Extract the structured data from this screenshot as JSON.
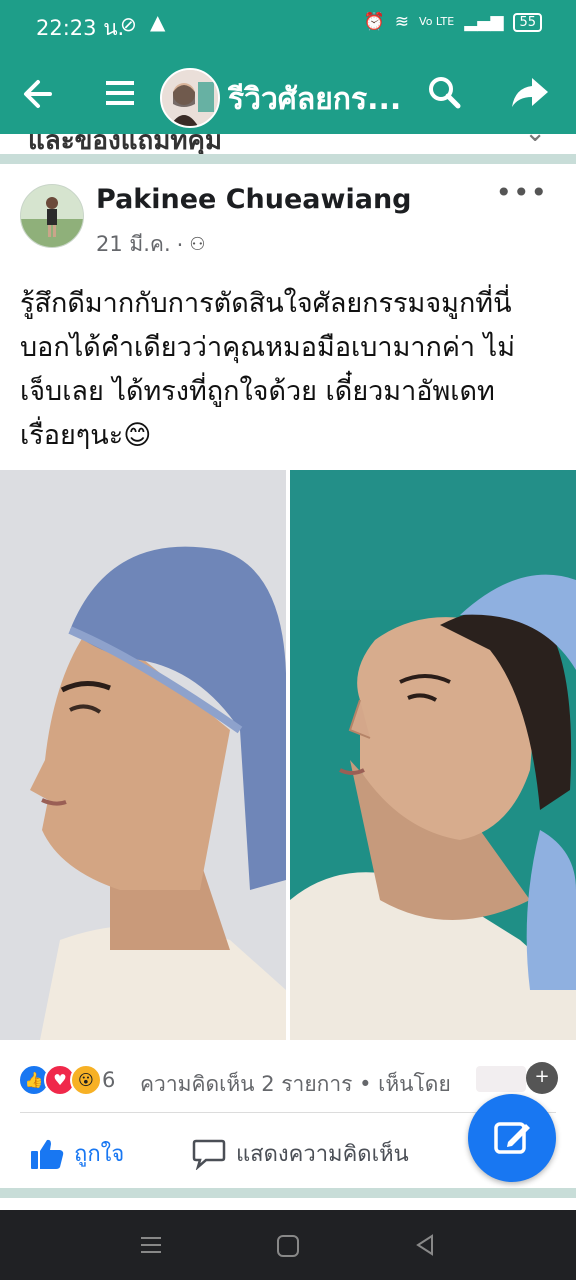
{
  "status_bar": {
    "time": "22:23 น.",
    "battery": "55",
    "network": "Vo LTE"
  },
  "app_bar": {
    "title": "รีวิวศัลยกร...",
    "icons": [
      "back-arrow-icon",
      "menu-icon",
      "search-icon",
      "share-icon"
    ]
  },
  "previous_post_strip": {
    "text": "และของแถมที่คุ้ม"
  },
  "post": {
    "author": "Pakinee Chueawiang",
    "date": "21 มี.ค.",
    "text_lines": [
      "รู้สึกดีมากกับการตัดสินใจศัลยกรรมจมูกที่นี่",
      "บอกได้คำเดียวว่าคุณหมอมือเบามากค่า ไม่",
      "เจ็บเลย ได้ทรงที่ถูกใจด้วย   เดี๋ยวมาอัพเดท",
      "เรื่อยๆนะ"
    ],
    "emoji": "😊",
    "reaction_count": "6",
    "comments_summary": "ความคิดเห็น 2 รายการ • เห็นโดย",
    "like_label": "ถูกใจ",
    "comment_label": "แสดงความคิดเห็น"
  },
  "colors": {
    "brand_green": "#1e9e89",
    "facebook_blue": "#1877f2",
    "separator": "#c8ddd8"
  }
}
